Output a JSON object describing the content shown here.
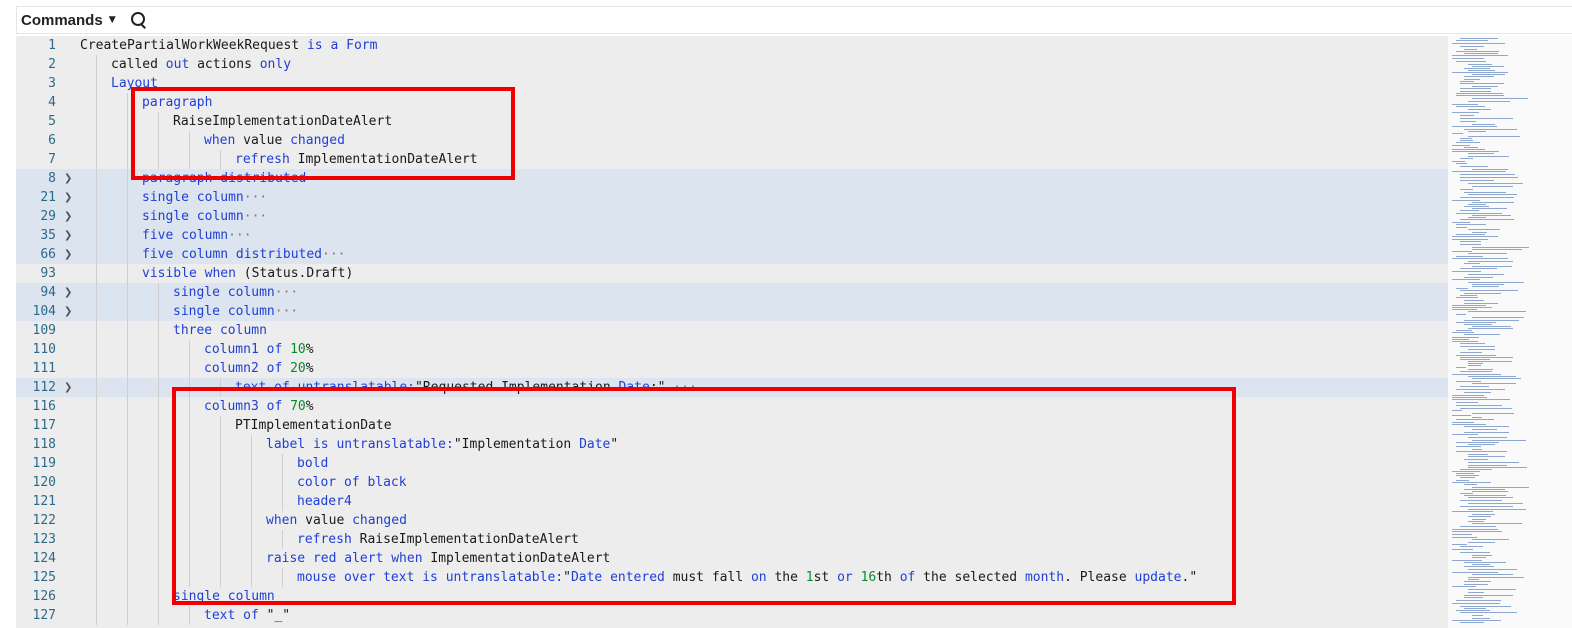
{
  "toolbar": {
    "commands_label": "Commands",
    "search_icon": "search-icon",
    "caret_icon": "caret-down-icon"
  },
  "colors": {
    "keyword": "#1f3fd6",
    "number": "#0a8a2a",
    "highlight_box": "#ee0000",
    "folded_bg": "#dce4ef"
  },
  "lines": [
    {
      "num": "1",
      "indent": 0,
      "fold": false,
      "folded": false,
      "tokens": [
        [
          "t",
          "CreatePartialWorkWeekRequest "
        ],
        [
          "k",
          "is a Form"
        ]
      ]
    },
    {
      "num": "2",
      "indent": 1,
      "fold": false,
      "folded": false,
      "tokens": [
        [
          "t",
          "called "
        ],
        [
          "k",
          "out"
        ],
        [
          "t",
          " actions "
        ],
        [
          "k",
          "only"
        ]
      ]
    },
    {
      "num": "3",
      "indent": 1,
      "fold": false,
      "folded": false,
      "tokens": [
        [
          "k",
          "Layout"
        ]
      ]
    },
    {
      "num": "4",
      "indent": 2,
      "fold": false,
      "folded": false,
      "tokens": [
        [
          "k",
          "paragraph"
        ]
      ]
    },
    {
      "num": "5",
      "indent": 3,
      "fold": false,
      "folded": false,
      "tokens": [
        [
          "t",
          "RaiseImplementationDateAlert"
        ]
      ]
    },
    {
      "num": "6",
      "indent": 4,
      "fold": false,
      "folded": false,
      "tokens": [
        [
          "k",
          "when"
        ],
        [
          "t",
          " value "
        ],
        [
          "k",
          "changed"
        ]
      ]
    },
    {
      "num": "7",
      "indent": 5,
      "fold": false,
      "folded": false,
      "tokens": [
        [
          "k",
          "refresh"
        ],
        [
          "t",
          " ImplementationDateAlert"
        ]
      ]
    },
    {
      "num": "8",
      "indent": 2,
      "fold": true,
      "folded": true,
      "tokens": [
        [
          "k",
          "paragraph distributed"
        ]
      ]
    },
    {
      "num": "21",
      "indent": 2,
      "fold": true,
      "folded": true,
      "tokens": [
        [
          "k",
          "single column"
        ],
        [
          "e",
          "···"
        ]
      ]
    },
    {
      "num": "29",
      "indent": 2,
      "fold": true,
      "folded": true,
      "tokens": [
        [
          "k",
          "single column"
        ],
        [
          "e",
          "···"
        ]
      ]
    },
    {
      "num": "35",
      "indent": 2,
      "fold": true,
      "folded": true,
      "tokens": [
        [
          "k",
          "five column"
        ],
        [
          "e",
          "···"
        ]
      ]
    },
    {
      "num": "66",
      "indent": 2,
      "fold": true,
      "folded": true,
      "tokens": [
        [
          "k",
          "five column distributed"
        ],
        [
          "e",
          "···"
        ]
      ]
    },
    {
      "num": "93",
      "indent": 2,
      "fold": false,
      "folded": false,
      "tokens": [
        [
          "k",
          "visible when"
        ],
        [
          "t",
          " (Status."
        ],
        [
          "t",
          "Draft)"
        ]
      ]
    },
    {
      "num": "94",
      "indent": 3,
      "fold": true,
      "folded": true,
      "tokens": [
        [
          "k",
          "single column"
        ],
        [
          "e",
          "···"
        ]
      ]
    },
    {
      "num": "104",
      "indent": 3,
      "fold": true,
      "folded": true,
      "tokens": [
        [
          "k",
          "single column"
        ],
        [
          "e",
          "···"
        ]
      ]
    },
    {
      "num": "109",
      "indent": 3,
      "fold": false,
      "folded": false,
      "tokens": [
        [
          "k",
          "three column"
        ]
      ]
    },
    {
      "num": "110",
      "indent": 4,
      "fold": false,
      "folded": false,
      "tokens": [
        [
          "k",
          "column1 of "
        ],
        [
          "n",
          "10"
        ],
        [
          "t",
          "%"
        ]
      ]
    },
    {
      "num": "111",
      "indent": 4,
      "fold": false,
      "folded": false,
      "tokens": [
        [
          "k",
          "column2 of "
        ],
        [
          "n",
          "20"
        ],
        [
          "t",
          "%"
        ]
      ]
    },
    {
      "num": "112",
      "indent": 5,
      "fold": true,
      "folded": true,
      "tokens": [
        [
          "k",
          "text of untranslatable:"
        ],
        [
          "t",
          "\"Requested Implementation "
        ],
        [
          "k",
          "Date"
        ],
        [
          "t",
          ":\""
        ],
        [
          "e",
          " ···"
        ]
      ]
    },
    {
      "num": "116",
      "indent": 4,
      "fold": false,
      "folded": false,
      "tokens": [
        [
          "k",
          "column3 of "
        ],
        [
          "n",
          "70"
        ],
        [
          "t",
          "%"
        ]
      ]
    },
    {
      "num": "117",
      "indent": 5,
      "fold": false,
      "folded": false,
      "tokens": [
        [
          "t",
          "PTImplementationDate"
        ]
      ]
    },
    {
      "num": "118",
      "indent": 6,
      "fold": false,
      "folded": false,
      "tokens": [
        [
          "k",
          "label is untranslatable:"
        ],
        [
          "t",
          "\"Implementation "
        ],
        [
          "k",
          "Date"
        ],
        [
          "t",
          "\""
        ]
      ]
    },
    {
      "num": "119",
      "indent": 7,
      "fold": false,
      "folded": false,
      "tokens": [
        [
          "k",
          "bold"
        ]
      ]
    },
    {
      "num": "120",
      "indent": 7,
      "fold": false,
      "folded": false,
      "tokens": [
        [
          "k",
          "color of black"
        ]
      ]
    },
    {
      "num": "121",
      "indent": 7,
      "fold": false,
      "folded": false,
      "tokens": [
        [
          "k",
          "header4"
        ]
      ]
    },
    {
      "num": "122",
      "indent": 6,
      "fold": false,
      "folded": false,
      "tokens": [
        [
          "k",
          "when"
        ],
        [
          "t",
          " value "
        ],
        [
          "k",
          "changed"
        ]
      ]
    },
    {
      "num": "123",
      "indent": 7,
      "fold": false,
      "folded": false,
      "tokens": [
        [
          "k",
          "refresh"
        ],
        [
          "t",
          " RaiseImplementationDateAlert"
        ]
      ]
    },
    {
      "num": "124",
      "indent": 6,
      "fold": false,
      "folded": false,
      "tokens": [
        [
          "k",
          "raise red alert when"
        ],
        [
          "t",
          " ImplementationDateAlert"
        ]
      ]
    },
    {
      "num": "125",
      "indent": 7,
      "fold": false,
      "folded": false,
      "tokens": [
        [
          "k",
          "mouse over text is untranslatable:"
        ],
        [
          "t",
          "\""
        ],
        [
          "k",
          "Date"
        ],
        [
          "t",
          " "
        ],
        [
          "k",
          "entered"
        ],
        [
          "t",
          " must fall "
        ],
        [
          "k",
          "on"
        ],
        [
          "t",
          " the "
        ],
        [
          "n",
          "1"
        ],
        [
          "t",
          "st "
        ],
        [
          "k",
          "or"
        ],
        [
          "t",
          " "
        ],
        [
          "n",
          "16"
        ],
        [
          "t",
          "th "
        ],
        [
          "k",
          "of"
        ],
        [
          "t",
          " the selected "
        ],
        [
          "k",
          "month"
        ],
        [
          "t",
          ". Please "
        ],
        [
          "k",
          "update"
        ],
        [
          "t",
          ".\""
        ]
      ]
    },
    {
      "num": "126",
      "indent": 3,
      "fold": false,
      "folded": false,
      "tokens": [
        [
          "k",
          "single column"
        ]
      ]
    },
    {
      "num": "127",
      "indent": 4,
      "fold": false,
      "folded": false,
      "tokens": [
        [
          "k",
          "text of"
        ],
        [
          "t",
          " \"_\""
        ]
      ]
    }
  ]
}
